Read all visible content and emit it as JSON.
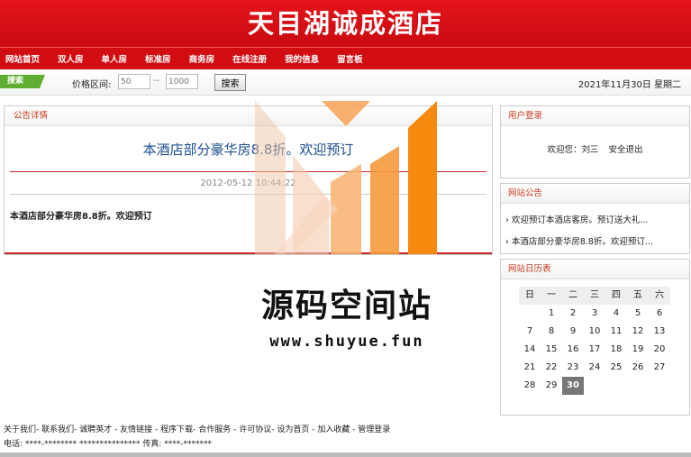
{
  "header": {
    "title": "天目湖诚成酒店"
  },
  "nav": [
    "网站首页",
    "双人房",
    "单人房",
    "标准房",
    "商务房",
    "在线注册",
    "我的信息",
    "留言板"
  ],
  "search": {
    "tag": "搜索",
    "price_label": "价格区间:",
    "min_placeholder": "50",
    "max_placeholder": "1000",
    "separator": "--",
    "button": "搜索"
  },
  "date": "2021年11月30日 星期二",
  "notice": {
    "section_title": "公告详情",
    "title": "本酒店部分豪华房8.8折。欢迎预订",
    "date": "2012-05-12 10:44:22",
    "body": "本酒店部分豪华房8.8折。欢迎预订"
  },
  "login": {
    "section_title": "用户登录",
    "welcome": "欢迎您：刘三",
    "logout": "安全退出"
  },
  "announce": {
    "section_title": "网站公告",
    "items": [
      "› 欢迎预订本酒店客房。预订送大礼...",
      "› 本酒店部分豪华房8.8折。欢迎预订..."
    ]
  },
  "calendar": {
    "section_title": "网站日历表",
    "weekdays": [
      "日",
      "一",
      "二",
      "三",
      "四",
      "五",
      "六"
    ],
    "days": [
      "",
      "1",
      "2",
      "3",
      "4",
      "5",
      "6",
      "7",
      "8",
      "9",
      "10",
      "11",
      "12",
      "13",
      "14",
      "15",
      "16",
      "17",
      "18",
      "19",
      "20",
      "21",
      "22",
      "23",
      "24",
      "25",
      "26",
      "27",
      "28",
      "29",
      "30"
    ],
    "today": "30"
  },
  "footer": {
    "links": "关于我们- 联系我们- 诚聘英才 - 友情链接 - 程序下载- 合作服务 - 许可协议- 设为首页 - 加入收藏 - 管理登录",
    "contact": "电话: ****-******** *************** 传真: ****-*******"
  },
  "watermark": {
    "text": "源码空间站",
    "url": "www.shuyue.fun"
  },
  "colors": {
    "header_red": "#d10d12",
    "search_green": "#5fae32",
    "title_blue": "#1b4d8f"
  }
}
